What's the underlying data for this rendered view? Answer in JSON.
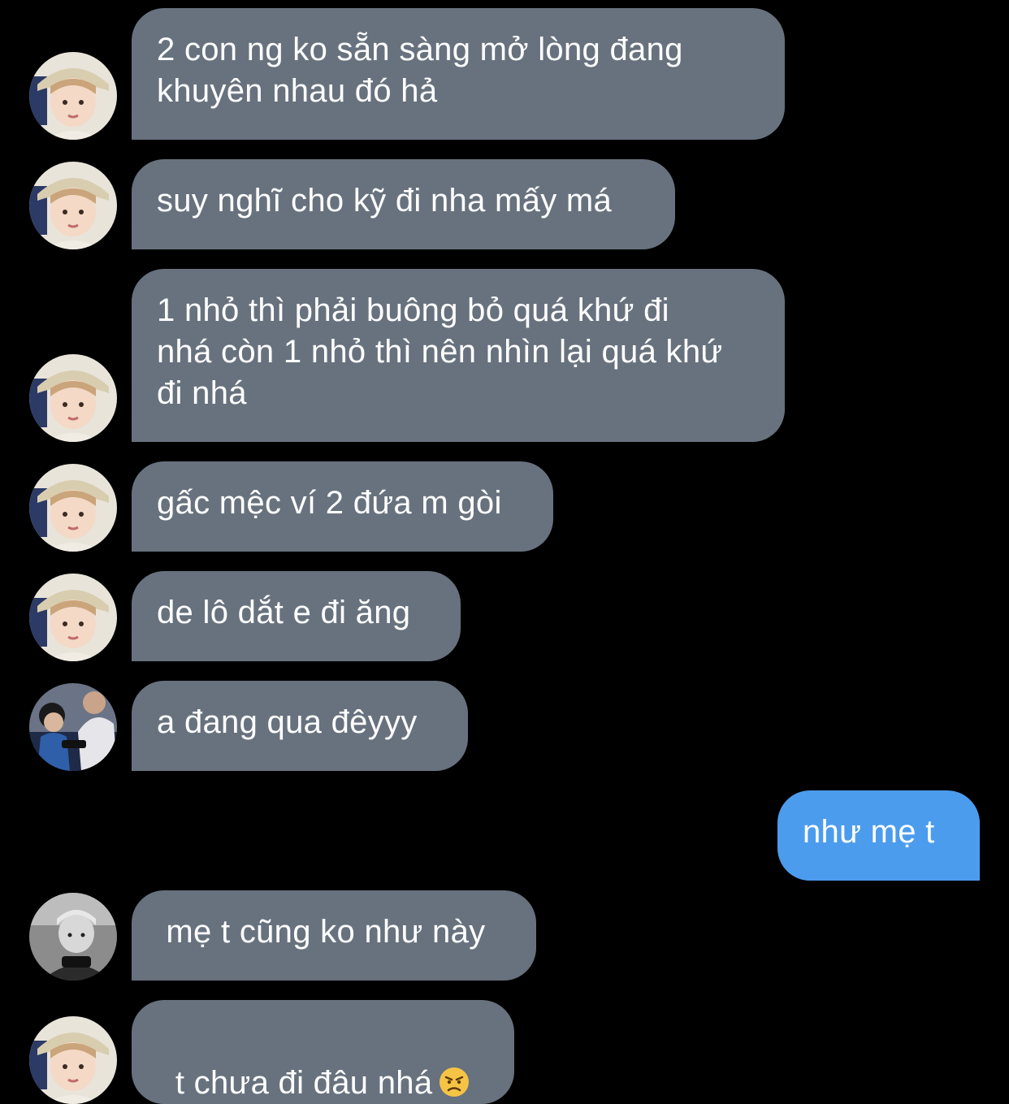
{
  "colors": {
    "background": "#000000",
    "incoming_bubble": "#68727e",
    "outgoing_bubble": "#4c9cee",
    "text": "#ffffff"
  },
  "messages": [
    {
      "direction": "incoming",
      "avatar": "avatar-hat-boy",
      "text": "2 con ng ko sẵn sàng mở lòng đang\nkhuyên nhau đó hả"
    },
    {
      "direction": "incoming",
      "avatar": "avatar-hat-boy",
      "text": "suy nghĩ cho kỹ đi nha mấy má"
    },
    {
      "direction": "incoming",
      "avatar": "avatar-hat-boy",
      "text": "1 nhỏ thì phải buông bỏ quá khứ đi\nnhá còn 1 nhỏ thì nên nhìn lại quá khứ\nđi nhá"
    },
    {
      "direction": "incoming",
      "avatar": "avatar-hat-boy",
      "text": "gấc mệc ví 2 đứa m gòi"
    },
    {
      "direction": "incoming",
      "avatar": "avatar-hat-boy",
      "text": "de lô dắt e đi ăng"
    },
    {
      "direction": "incoming",
      "avatar": "avatar-couple-photo",
      "text": "a đang qua đêyyy"
    },
    {
      "direction": "outgoing",
      "text": "như mẹ t"
    },
    {
      "direction": "incoming",
      "avatar": "avatar-bw-photo",
      "text": " mẹ t cũng ko như này"
    },
    {
      "direction": "incoming",
      "avatar": "avatar-hat-boy",
      "text": "t chưa đi đâu nhá",
      "emoji": "angry-face-emoji"
    }
  ]
}
